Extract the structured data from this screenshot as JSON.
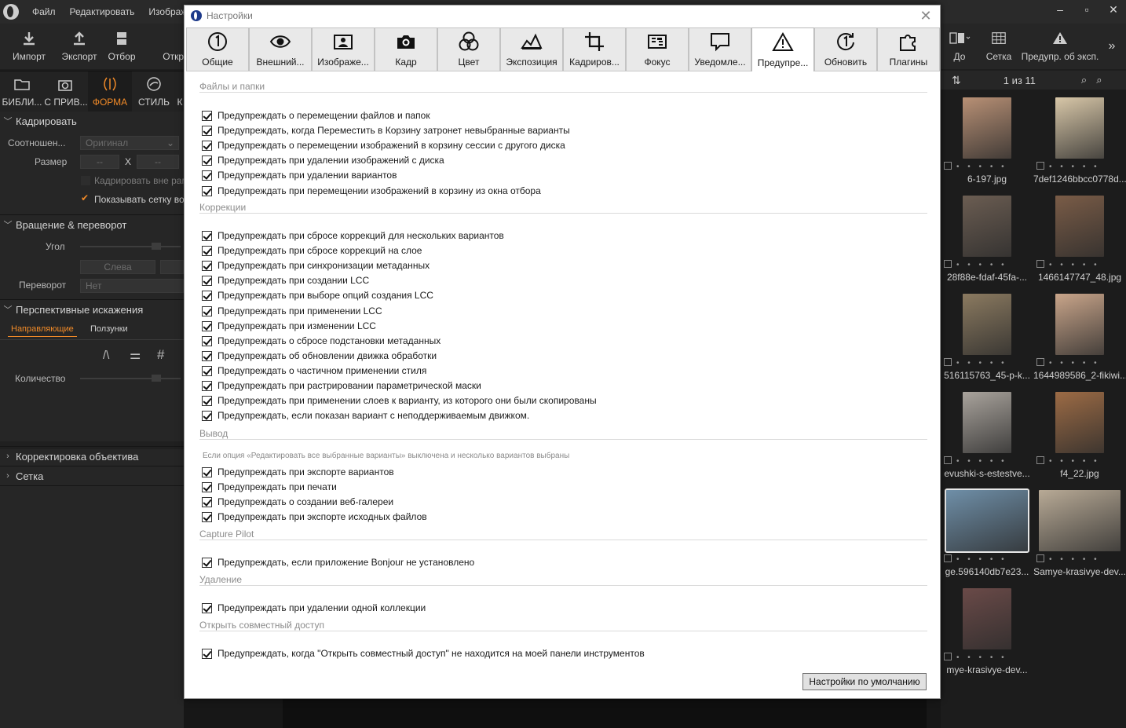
{
  "app": {
    "menu": [
      "Файл",
      "Редактировать",
      "Изображ"
    ],
    "left_toolbar": [
      {
        "label": "Импорт",
        "icon": "import-icon"
      },
      {
        "label": "Экспорт",
        "icon": "export-icon"
      },
      {
        "label": "Отбор",
        "icon": "cull-icon"
      },
      {
        "label": "Откр",
        "icon": ""
      }
    ],
    "left_tabs": [
      {
        "label": "БИБЛИ...",
        "icon": "library-icon",
        "active": false
      },
      {
        "label": "С ПРИВ...",
        "icon": "capture-icon",
        "active": false
      },
      {
        "label": "ФОРМА",
        "icon": "lens-icon",
        "active": true
      },
      {
        "label": "СТИЛЬ",
        "icon": "style-icon",
        "active": false
      },
      {
        "label": "К",
        "icon": "",
        "active": false
      }
    ],
    "left_panel": {
      "crop_title": "Кадрировать",
      "ratio_label": "Соотношен...",
      "ratio_value": "Оригинал",
      "size_label": "Размер",
      "size_w": "--",
      "size_x": "X",
      "size_h": "--",
      "crop_outside": "Кадрировать вне рам",
      "show_grid": "Показывать сетку во",
      "rotate_title": "Вращение & переворот",
      "angle_label": "Угол",
      "left_btn": "Слева",
      "flip_label": "Переворот",
      "flip_value": "Нет",
      "persp_title": "Перспективные искажения",
      "guides_tab": "Направляющие",
      "sliders_tab": "Ползунки",
      "count_label": "Количество",
      "lens_title": "Корректировка объектива",
      "grid_title": "Сетка"
    },
    "right_toolbar": [
      {
        "label": "До",
        "icon": "before-after-icon"
      },
      {
        "label": "Сетка",
        "icon": "grid-icon"
      },
      {
        "label": "Предупр. об эксп.",
        "icon": "exposure-warning-icon"
      }
    ],
    "browser": {
      "counter": "1 из 11",
      "thumbs": [
        {
          "name": "6-197.jpg",
          "color": "#b89075"
        },
        {
          "name": "7def1246bbcc0778d...",
          "color": "#d8c7a8"
        },
        {
          "name": "28f88e-fdaf-45fa-...",
          "color": "#6b5d52"
        },
        {
          "name": "1466147747_48.jpg",
          "color": "#7a5c47"
        },
        {
          "name": "516115763_45-p-k...",
          "color": "#8b7a60"
        },
        {
          "name": "1644989586_2-fikiwi...",
          "color": "#c9a58a"
        },
        {
          "name": "evushki-s-estestve...",
          "color": "#a9a39c"
        },
        {
          "name": "f4_22.jpg",
          "color": "#9c6b45"
        },
        {
          "name": "ge.596140db7e23...",
          "color": "#6f8fa8"
        },
        {
          "name": "Samye-krasivye-dev...",
          "color": "#b8aa96"
        },
        {
          "name": "mye-krasivye-dev...",
          "color": "#6a4a48"
        }
      ]
    }
  },
  "dialog": {
    "title": "Настройки",
    "tabs": [
      {
        "label": "Общие",
        "icon": "general-icon"
      },
      {
        "label": "Внешний...",
        "icon": "eye-icon"
      },
      {
        "label": "Изображе...",
        "icon": "image-icon"
      },
      {
        "label": "Кадр",
        "icon": "camera-icon"
      },
      {
        "label": "Цвет",
        "icon": "color-icon"
      },
      {
        "label": "Экспозиция",
        "icon": "exposure-icon"
      },
      {
        "label": "Кадриров...",
        "icon": "crop-icon"
      },
      {
        "label": "Фокус",
        "icon": "focus-icon"
      },
      {
        "label": "Уведомле...",
        "icon": "notification-icon"
      },
      {
        "label": "Предупре...",
        "icon": "warning-icon"
      },
      {
        "label": "Обновить",
        "icon": "update-icon"
      },
      {
        "label": "Плагины",
        "icon": "plugin-icon"
      }
    ],
    "active_tab": 9,
    "sections": [
      {
        "title": "Файлы и папки",
        "items": [
          "Предупреждать о перемещении файлов и папок",
          "Предупреждать, когда Переместить в Корзину затронет невыбранные варианты",
          "Предупреждать о перемещении изображений в корзину сессии с другого диска",
          "Предупреждать при удалении изображений с диска",
          "Предупреждать при удалении вариантов",
          "Предупреждать при перемещении изображений в корзину из окна отбора"
        ]
      },
      {
        "title": "Коррекции",
        "items": [
          "Предупреждать при сбросе коррекций для нескольких вариантов",
          "Предупреждать при сбросе коррекций на слое",
          "Предупреждать при синхронизации метаданных",
          "Предупреждать при создании LCC",
          "Предупреждать при выборе опций создания LCC",
          "Предупреждать при применении LCC",
          "Предупреждать при изменении LCC",
          "Предупреждать о сбросе подстановки метаданных",
          "Предупреждать об обновлении движка обработки",
          "Предупреждать о частичном применении стиля",
          "Предупреждать при растрировании параметрической маски",
          "Предупреждать при применении слоев к варианту, из которого они были скопированы",
          "Предупреждать, если показан вариант с неподдерживаемым движком."
        ]
      },
      {
        "title": "Вывод",
        "note": "Если опция «Редактировать все выбранные варианты» выключена и несколько вариантов выбраны",
        "items": [
          "Предупреждать при экспорте вариантов",
          "Предупреждать при печати",
          "Предупреждать о создании веб-галереи",
          "Предупреждать при экспорте исходных файлов"
        ]
      },
      {
        "title": "Capture Pilot",
        "items": [
          "Предупреждать, если приложение Bonjour не установлено"
        ]
      },
      {
        "title": "Удаление",
        "items": [
          "Предупреждать при удалении одной коллекции"
        ]
      },
      {
        "title": "Открыть совместный доступ",
        "items": [
          "Предупреждать, когда \"Открыть совместный доступ\" не находится на моей панели инструментов"
        ]
      }
    ],
    "default_button": "Настройки по умолчанию"
  }
}
